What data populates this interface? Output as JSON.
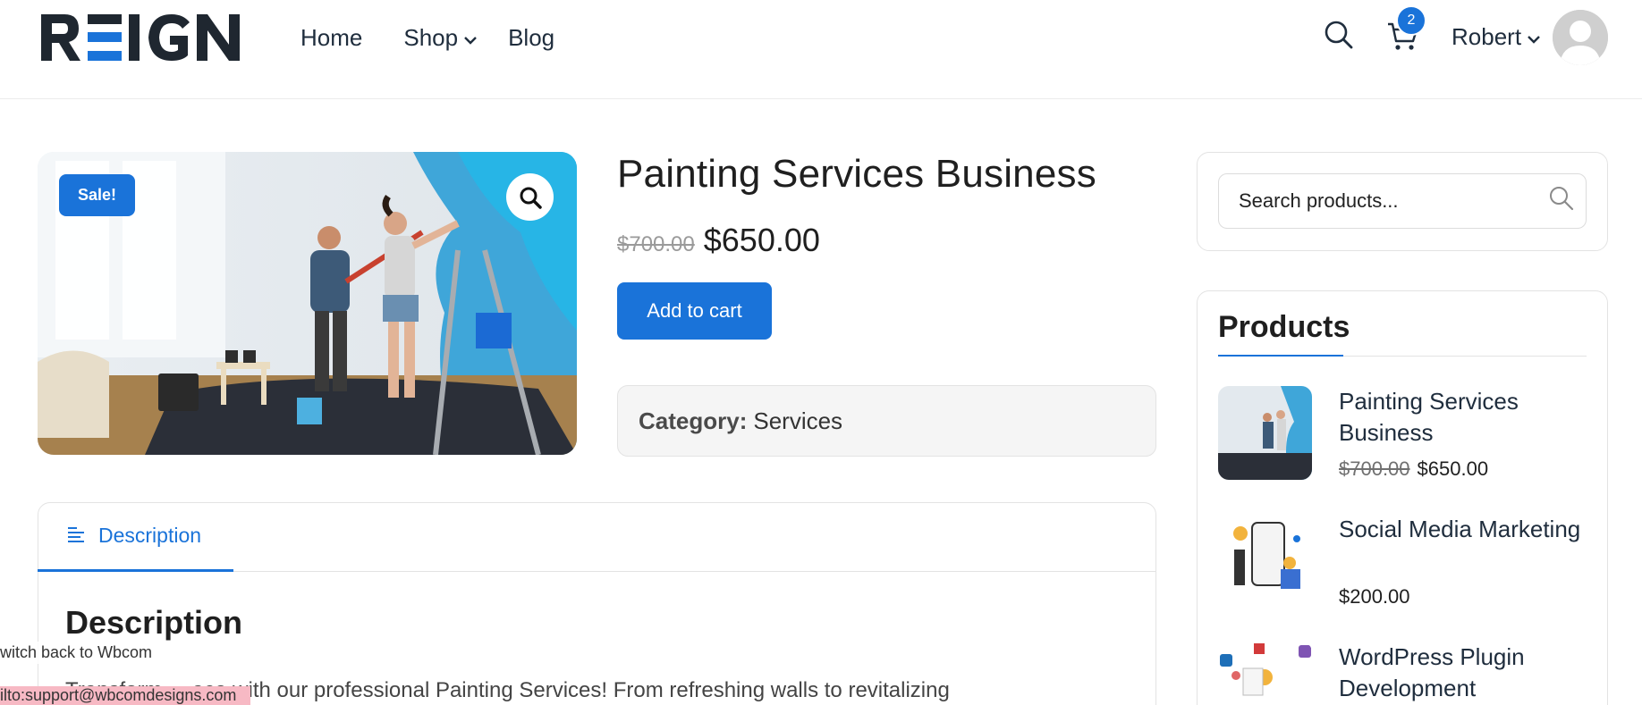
{
  "header": {
    "logo_text": "REIGN",
    "nav": [
      {
        "label": "Home"
      },
      {
        "label": "Shop"
      },
      {
        "label": "Blog"
      }
    ],
    "cart_count": "2",
    "user_name": "Robert"
  },
  "product": {
    "sale_badge": "Sale!",
    "title": "Painting Services Business",
    "price_old": "$700.00",
    "price_new": "$650.00",
    "add_to_cart": "Add to cart",
    "category_label": "Category:",
    "category_value": "Services"
  },
  "tabs": {
    "description_tab": "Description",
    "description_heading": "Description",
    "description_text_visible": "Transform ... ace with our professional Painting Services! From refreshing walls to revitalizing"
  },
  "overlay": {
    "switch_back": "witch back to Wbcom",
    "mail_link": "ilto:support@wbcomdesigns.com"
  },
  "sidebar": {
    "search_placeholder": "Search products...",
    "products_title": "Products",
    "items": [
      {
        "name": "Painting Services Business",
        "price_old": "$700.00",
        "price": "$650.00"
      },
      {
        "name": "Social Media Marketing",
        "price_old": "",
        "price": "$200.00"
      },
      {
        "name": "WordPress Plugin Development",
        "price_old": "",
        "price": ""
      }
    ]
  },
  "colors": {
    "accent": "#1a73d9",
    "text": "#1f1f1f",
    "badge_pink": "#f7b9c4"
  }
}
